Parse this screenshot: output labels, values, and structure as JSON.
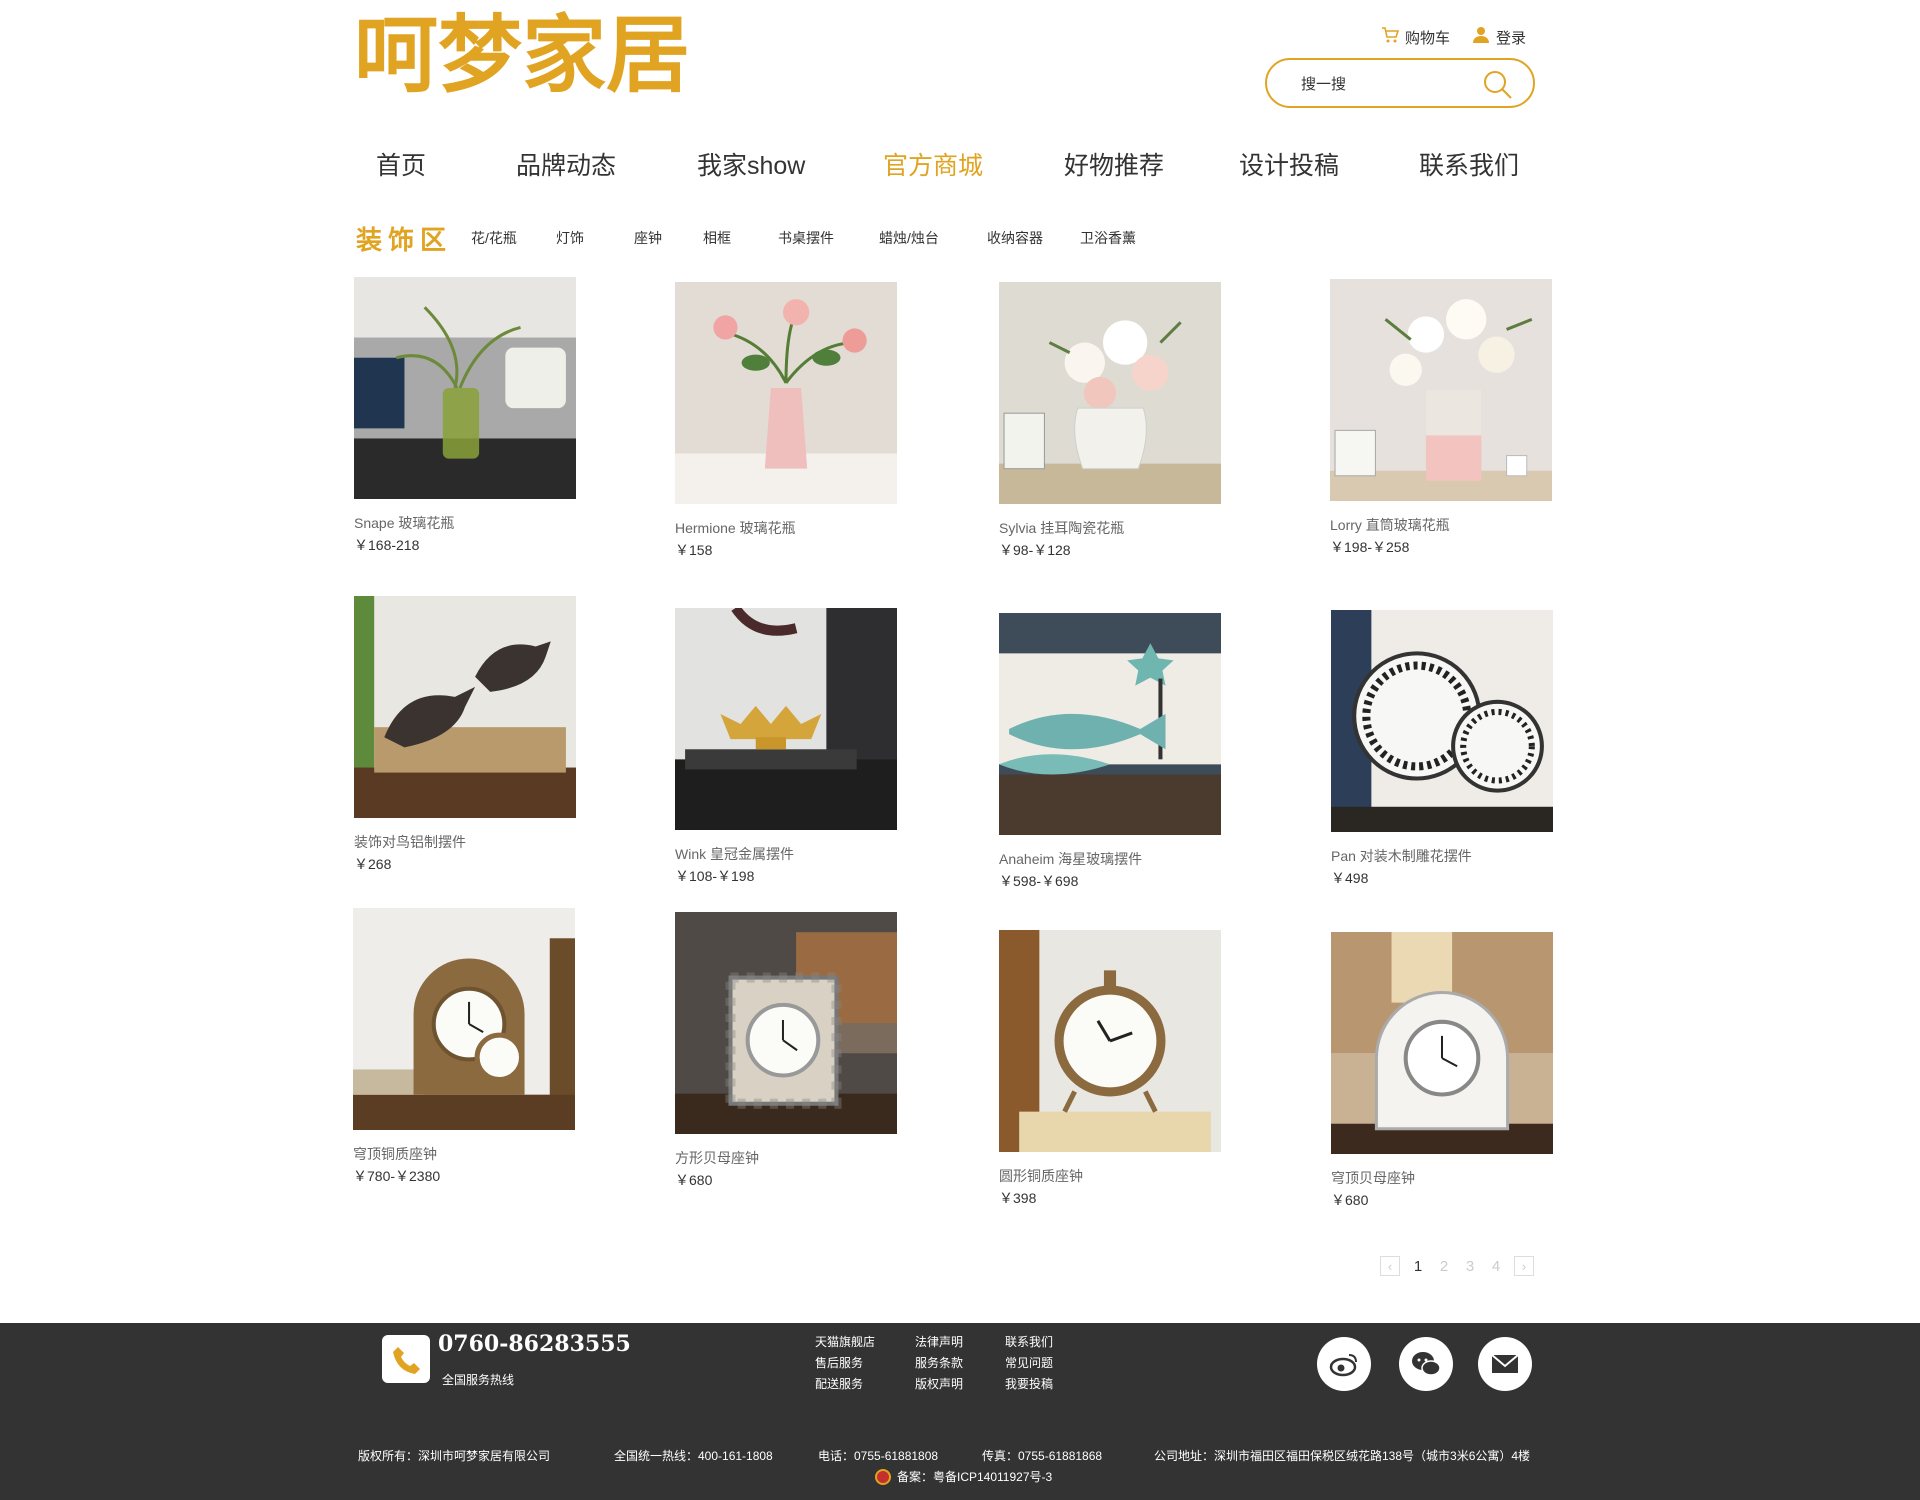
{
  "brand": {
    "logo_text": "呵梦家居",
    "accent": "#e1a422"
  },
  "header": {
    "cart_label": "购物车",
    "login_label": "登录",
    "search_placeholder": "搜一搜"
  },
  "nav": [
    {
      "label": "首页",
      "active": false
    },
    {
      "label": "品牌动态",
      "active": false
    },
    {
      "label": "我家show",
      "active": false
    },
    {
      "label": "官方商城",
      "active": true
    },
    {
      "label": "好物推荐",
      "active": false
    },
    {
      "label": "设计投稿",
      "active": false
    },
    {
      "label": "联系我们",
      "active": false
    }
  ],
  "category": {
    "title": "装饰区",
    "items": [
      "花/花瓶",
      "灯饰",
      "座钟",
      "相框",
      "书桌摆件",
      "蜡烛/烛台",
      "收纳容器",
      "卫浴香薰"
    ]
  },
  "products": [
    {
      "name": "Snape 玻璃花瓶",
      "price": "￥168-218",
      "image": "vase-green-glass"
    },
    {
      "name": "Hermione 玻璃花瓶",
      "price": "￥158",
      "image": "vase-pink-peony"
    },
    {
      "name": "Sylvia 挂耳陶瓷花瓶",
      "price": "￥98-￥128",
      "image": "vase-white-ceramic"
    },
    {
      "name": "Lorry 直筒玻璃花瓶",
      "price": "￥198-￥258",
      "image": "vase-pink-striped"
    },
    {
      "name": "装饰对鸟铝制摆件",
      "price": "￥268",
      "image": "bird-pair"
    },
    {
      "name": "Wink 皇冠金属摆件",
      "price": "￥108-￥198",
      "image": "gold-crown"
    },
    {
      "name": "Anaheim 海星玻璃摆件",
      "price": "￥598-￥698",
      "image": "glass-fish"
    },
    {
      "name": "Pan 对装木制雕花摆件",
      "price": "￥498",
      "image": "carved-plates"
    },
    {
      "name": "穹顶铜质座钟",
      "price": "￥780-￥2380",
      "image": "dome-brass-clock"
    },
    {
      "name": "方形贝母座钟",
      "price": "￥680",
      "image": "square-shell-clock"
    },
    {
      "name": "圆形铜质座钟",
      "price": "￥398",
      "image": "round-brass-clock"
    },
    {
      "name": "穹顶贝母座钟",
      "price": "￥680",
      "image": "dome-shell-clock"
    }
  ],
  "pagination": {
    "pages": [
      "1",
      "2",
      "3",
      "4"
    ],
    "current": "1",
    "prev": "‹",
    "next": "›"
  },
  "footer": {
    "hotline": "0760-86283555",
    "hotline_label": "全国服务热线",
    "links": [
      "天猫旗舰店",
      "法律声明",
      "联系我们",
      "售后服务",
      "服务条款",
      "常见问题",
      "配送服务",
      "版权声明",
      "我要投稿"
    ],
    "social": [
      "weibo-icon",
      "wechat-icon",
      "mail-icon"
    ],
    "copyright": "版权所有：深圳市呵梦家居有限公司",
    "national_hotline": "全国统一热线：400-161-1808",
    "tel": "电话：0755-61881808",
    "fax": "传真：0755-61881868",
    "address": "公司地址：深圳市福田区福田保税区绒花路138号（城市3米6公寓）4楼",
    "icp": "备案：粤备ICP14011927号-3"
  }
}
